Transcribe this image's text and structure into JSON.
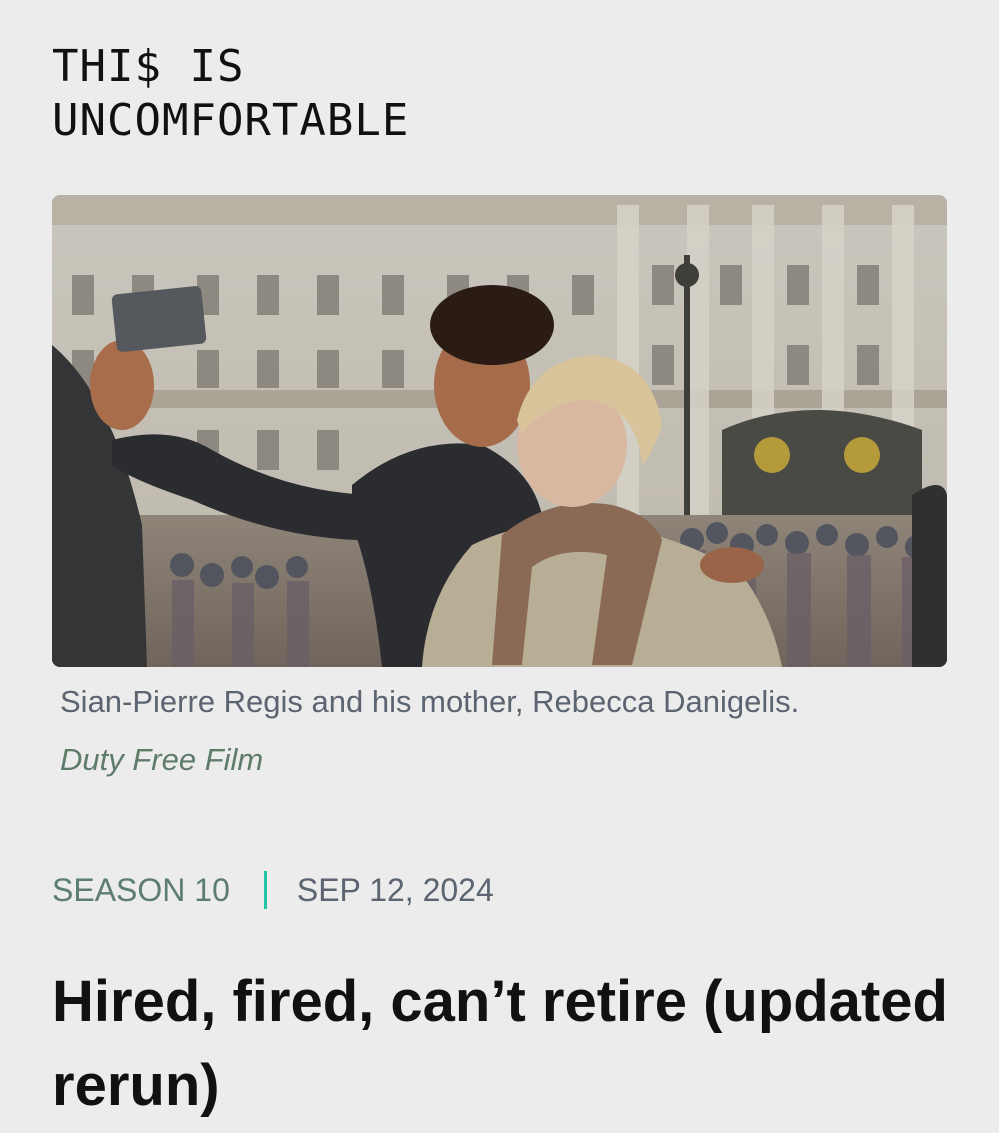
{
  "header": {
    "logo_line1": "THI$ IS",
    "logo_line2": "UNCOMFORTABLE"
  },
  "hero_image": {
    "caption": "Sian-Pierre Regis and his mother, Rebecca Danigelis.",
    "credit": "Duty Free Film"
  },
  "episode": {
    "season": "SEASON 10",
    "date": "SEP 12, 2024",
    "title": "Hired, fired, can’t retire (updated rerun)"
  },
  "colors": {
    "background": "#ececec",
    "separator": "#22c3a6",
    "season_text": "#5d7e6e",
    "caption_text": "#5b6470"
  }
}
